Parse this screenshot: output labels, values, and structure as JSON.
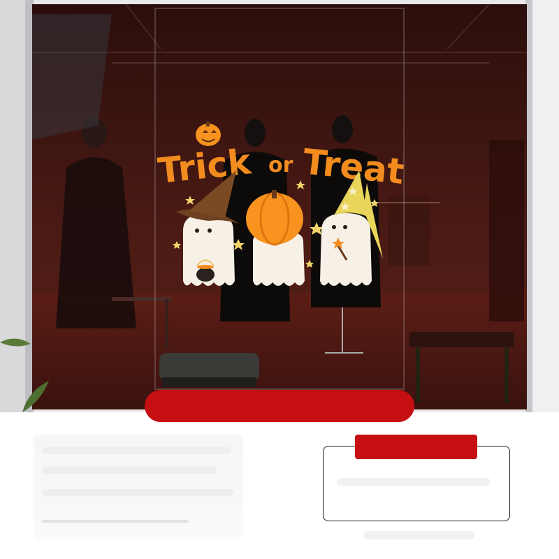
{
  "sticker": {
    "title_word1": "Trick",
    "title_word2": "or",
    "title_word3": "Treat"
  },
  "colors": {
    "title_orange": "#f28c1e",
    "pumpkin": "#f7931e",
    "hat_brown": "#7a4a24",
    "hat_yellow": "#e9d55a",
    "ghost_white": "#f6f0e6",
    "red_banner": "#c50f12",
    "store_interior": "#3a1512"
  },
  "icons": [
    "pumpkin-icon",
    "witch-hat-icon",
    "wizard-hat-icon",
    "cauldron-icon",
    "wand-icon",
    "star-icon"
  ]
}
